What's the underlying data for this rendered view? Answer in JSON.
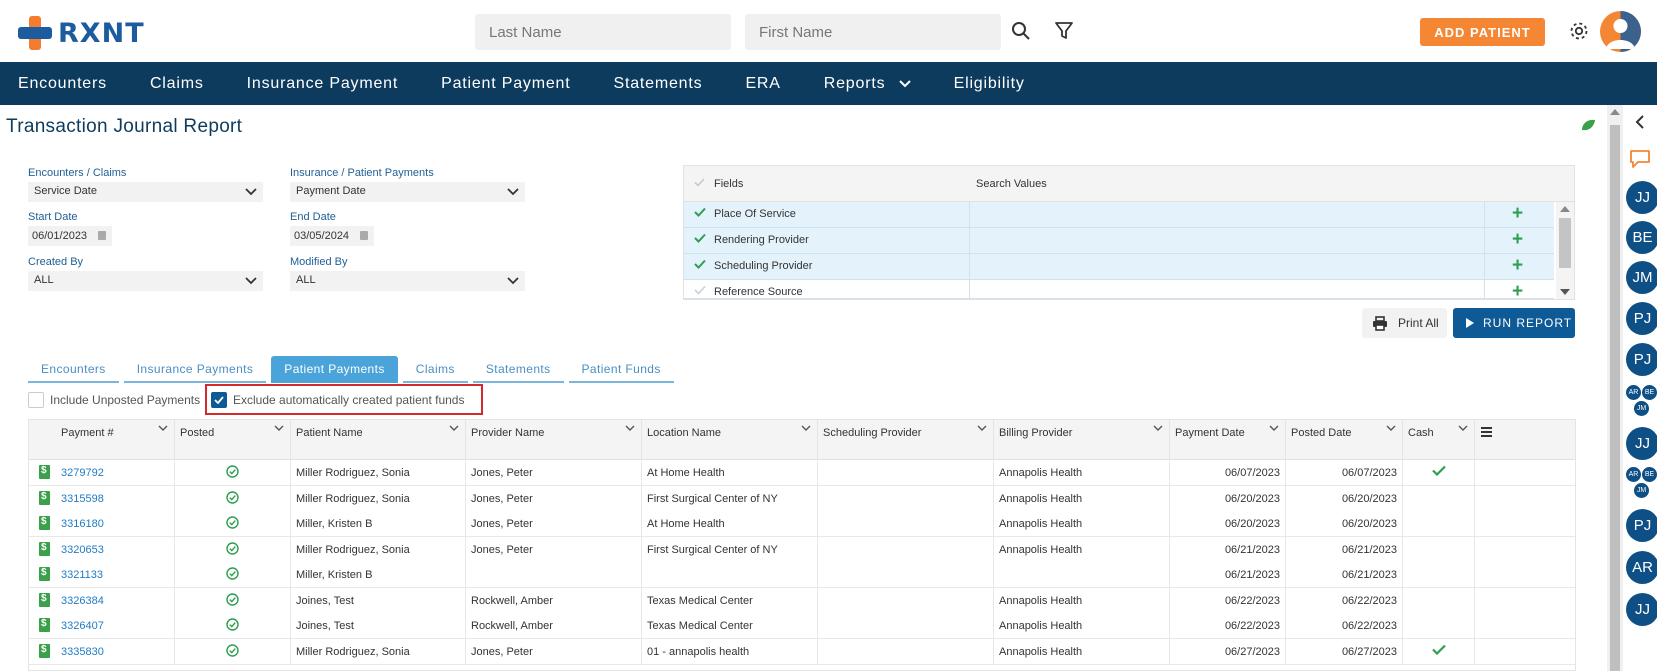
{
  "header": {
    "logo_text": "RXNT",
    "last_name_placeholder": "Last Name",
    "first_name_placeholder": "First Name",
    "add_patient_label": "ADD PATIENT"
  },
  "nav": {
    "items": [
      "Encounters",
      "Claims",
      "Insurance Payment",
      "Patient Payment",
      "Statements",
      "ERA",
      "Reports",
      "Eligibility"
    ]
  },
  "page": {
    "title": "Transaction Journal Report"
  },
  "filters": {
    "encounters_label": "Encounters / Claims",
    "encounters_value": "Service Date",
    "payments_label": "Insurance / Patient Payments",
    "payments_value": "Payment Date",
    "start_label": "Start Date",
    "start_value": "06/01/2023",
    "end_label": "End Date",
    "end_value": "03/05/2024",
    "created_label": "Created By",
    "created_value": "ALL",
    "modified_label": "Modified By",
    "modified_value": "ALL"
  },
  "fields_grid": {
    "col_fields": "Fields",
    "col_values": "Search Values",
    "rows": [
      "Place Of Service",
      "Rendering Provider",
      "Scheduling Provider",
      "Reference Source"
    ]
  },
  "actions": {
    "print_label": "Print All",
    "run_label": "RUN REPORT"
  },
  "tabs": [
    "Encounters",
    "Insurance Payments",
    "Patient Payments",
    "Claims",
    "Statements",
    "Patient Funds"
  ],
  "options": {
    "include_unposted": "Include Unposted Payments",
    "exclude_auto": "Exclude automatically created patient funds"
  },
  "table": {
    "columns": [
      "Payment #",
      "Posted",
      "Patient Name",
      "Provider Name",
      "Location Name",
      "Scheduling Provider",
      "Billing Provider",
      "Payment Date",
      "Posted Date",
      "Cash"
    ],
    "rows": [
      {
        "payment": "3279792",
        "patient": "Miller Rodriguez, Sonia",
        "provider": "Jones, Peter",
        "location": "At Home Health",
        "scheduling": "",
        "billing": "Annapolis Health",
        "payment_date": "06/07/2023",
        "posted_date": "06/07/2023",
        "cash": true
      },
      {
        "payment": "3315598",
        "patient": "Miller Rodriguez, Sonia",
        "provider": "Jones, Peter",
        "location": "First Surgical Center of NY",
        "scheduling": "",
        "billing": "Annapolis Health",
        "payment_date": "06/20/2023",
        "posted_date": "06/20/2023",
        "cash": false
      },
      {
        "payment": "3316180",
        "patient": "Miller, Kristen B",
        "provider": "Jones, Peter",
        "location": "At Home Health",
        "scheduling": "",
        "billing": "Annapolis Health",
        "payment_date": "06/20/2023",
        "posted_date": "06/20/2023",
        "cash": false
      },
      {
        "payment": "3320653",
        "patient": "Miller Rodriguez, Sonia",
        "provider": "Jones, Peter",
        "location": "First Surgical Center of NY",
        "scheduling": "",
        "billing": "Annapolis Health",
        "payment_date": "06/21/2023",
        "posted_date": "06/21/2023",
        "cash": false
      },
      {
        "payment": "3321133",
        "patient": "Miller, Kristen B",
        "provider": "",
        "location": "",
        "scheduling": "",
        "billing": "",
        "payment_date": "06/21/2023",
        "posted_date": "06/21/2023",
        "cash": false
      },
      {
        "payment": "3326384",
        "patient": "Joines, Test",
        "provider": "Rockwell, Amber",
        "location": "Texas Medical Center",
        "scheduling": "",
        "billing": "Annapolis Health",
        "payment_date": "06/22/2023",
        "posted_date": "06/22/2023",
        "cash": false
      },
      {
        "payment": "3326407",
        "patient": "Joines, Test",
        "provider": "Rockwell, Amber",
        "location": "Texas Medical Center",
        "scheduling": "",
        "billing": "Annapolis Health",
        "payment_date": "06/22/2023",
        "posted_date": "06/22/2023",
        "cash": false
      },
      {
        "payment": "3335830",
        "patient": "Miller Rodriguez, Sonia",
        "provider": "Jones, Peter",
        "location": "01 - annapolis health",
        "scheduling": "",
        "billing": "Annapolis Health",
        "payment_date": "06/27/2023",
        "posted_date": "06/27/2023",
        "cash": true
      }
    ]
  },
  "rail": {
    "initials": [
      "JJ",
      "BE",
      "JM",
      "PJ",
      "PJ",
      "JJ",
      "PJ",
      "AR",
      "JJ"
    ],
    "mini_group_1": [
      "AR",
      "BE",
      "JM"
    ],
    "mini_group_2": [
      "AR",
      "BE",
      "JM"
    ]
  },
  "colors": {
    "nav_bg": "#0d3b5e",
    "accent_orange": "#f58634",
    "primary_blue": "#0e5a96",
    "tab_active": "#4aa3d9",
    "success_green": "#2e9e4f",
    "highlight_red": "#d42a2a"
  }
}
